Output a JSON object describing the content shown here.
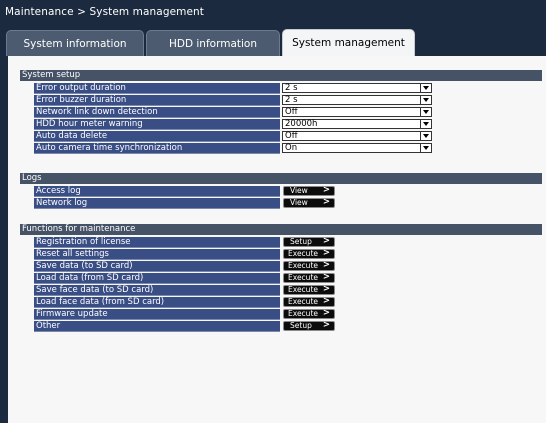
{
  "breadcrumb": "Maintenance > System management",
  "tabs": {
    "system_information": "System information",
    "hdd_information": "HDD information",
    "system_management": "System management"
  },
  "active_tab": "system_management",
  "system_setup": {
    "title": "System setup",
    "rows": [
      {
        "label": "Error output duration",
        "value": "2 s"
      },
      {
        "label": "Error buzzer duration",
        "value": "2 s"
      },
      {
        "label": "Network link down detection",
        "value": "Off"
      },
      {
        "label": "HDD hour meter warning",
        "value": "20000h"
      },
      {
        "label": "Auto data delete",
        "value": "Off"
      },
      {
        "label": "Auto camera time synchronization",
        "value": "On"
      }
    ]
  },
  "logs": {
    "title": "Logs",
    "rows": [
      {
        "label": "Access log",
        "button": "View"
      },
      {
        "label": "Network log",
        "button": "View"
      }
    ]
  },
  "maintenance": {
    "title": "Functions for maintenance",
    "rows": [
      {
        "label": "Registration of license",
        "button": "Setup"
      },
      {
        "label": "Reset all settings",
        "button": "Execute"
      },
      {
        "label": "Save data (to SD card)",
        "button": "Execute"
      },
      {
        "label": "Load data (from SD card)",
        "button": "Execute"
      },
      {
        "label": "Save face data (to SD card)",
        "button": "Execute"
      },
      {
        "label": "Load face data (from SD card)",
        "button": "Execute"
      },
      {
        "label": "Firmware update",
        "button": "Execute"
      },
      {
        "label": "Other",
        "button": "Setup"
      }
    ]
  },
  "chevron_glyph": ">",
  "colors": {
    "header_bar": "#1c2a3f",
    "section_header": "#465266",
    "row_label": "#3a4e86",
    "button": "#0c0c0c"
  }
}
